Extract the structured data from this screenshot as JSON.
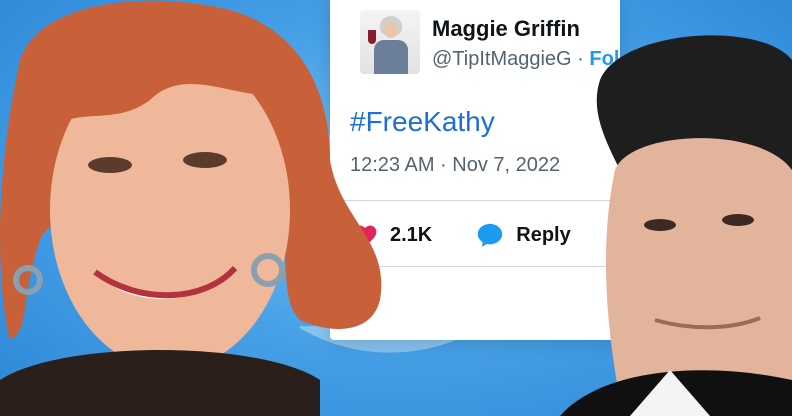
{
  "tweet": {
    "display_name": "Maggie Griffin",
    "handle": "@TipItMaggieG",
    "separator": " · ",
    "follow_label": "Fol",
    "text": "#FreeKathy",
    "timestamp": "12:23 AM · Nov 7, 2022",
    "likes_count": "2.1K",
    "reply_label": "Reply"
  },
  "colors": {
    "background": "#4aa3e8",
    "heart": "#e0245e",
    "reply_icon": "#1d9bf0",
    "hashtag": "#1d6fd6"
  },
  "icons": [
    "heart-icon",
    "reply-icon",
    "twitter-bird-icon"
  ]
}
